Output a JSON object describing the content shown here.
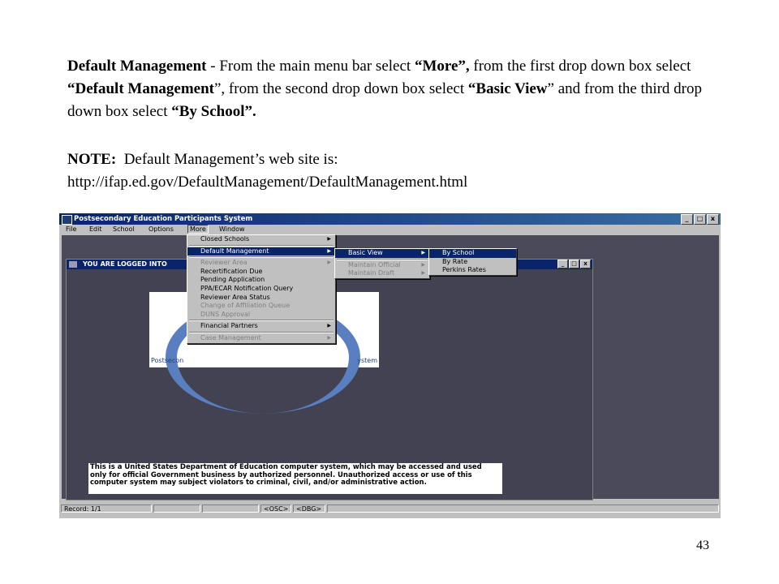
{
  "instructions": {
    "title": "Default Management",
    "t1": " - From the main menu bar select ",
    "q_more": "“More”,",
    "t2": " from the first drop down box select ",
    "q_dm": "“Default Management",
    "t3": "”, from the second drop down box select ",
    "q_bv": "“Basic View",
    "t4": "” and from the third drop down box select ",
    "q_bs": "“By School”."
  },
  "note": {
    "label": "NOTE:",
    "text": "  Default Management’s web site is:",
    "url": "http://ifap.ed.gov/DefaultManagement/DefaultManagement.html"
  },
  "page_number": "43",
  "app": {
    "title": "Postsecondary Education Participants System",
    "window_buttons": [
      "_",
      "□",
      "x"
    ],
    "menu": [
      "File",
      "Edit",
      "School",
      "Options",
      "More",
      "Window"
    ],
    "child_title": "YOU ARE LOGGED INTO",
    "logo_left": "Postsecon",
    "logo_right": "ystem",
    "warning": "This is a United States Department of Education computer system, which may be accessed and used only for official Government business by authorized personnel. Unauthorized access or use of this computer system may subject violators to criminal, civil, and/or administrative action.",
    "more_menu": [
      "Closed Schools",
      "Default Management",
      "Reviewer Area",
      "Recertification Due",
      "Pending Application",
      "PPA/ECAR Notification Query",
      "Reviewer Area Status",
      "Change of Affiliation Queue",
      "DUNS Approval",
      "Financial Partners",
      "Case Management"
    ],
    "dm_menu": [
      "Basic View",
      "Maintain Official",
      "Maintain Draft"
    ],
    "bv_menu": [
      "By School",
      "By Rate",
      "Perkins Rates"
    ],
    "status": [
      "Record: 1/1",
      "",
      "",
      "<OSC>",
      "<DBG>"
    ]
  }
}
